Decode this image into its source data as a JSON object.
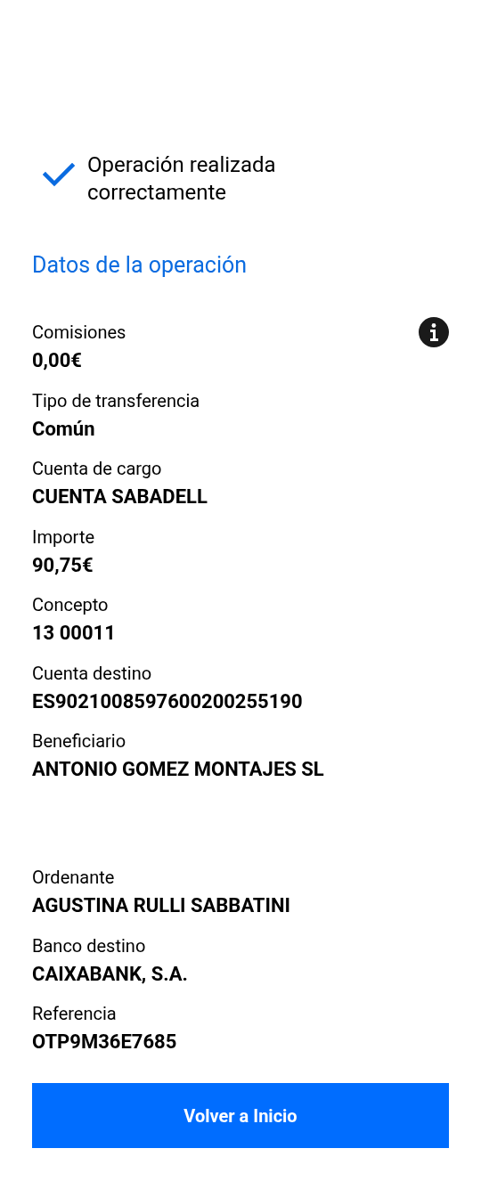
{
  "status": {
    "title": "Operación realizada correctamente"
  },
  "heading": "Datos de la operación",
  "details": [
    {
      "label": "Comisiones",
      "value": "0,00€",
      "info": true
    },
    {
      "label": "Tipo de transferencia",
      "value": "Común",
      "info": false
    },
    {
      "label": "Cuenta de cargo",
      "value": "CUENTA SABADELL",
      "info": false
    },
    {
      "label": "Importe",
      "value": "90,75€",
      "info": false
    },
    {
      "label": "Concepto",
      "value": "13 00011",
      "info": false
    },
    {
      "label": "Cuenta destino",
      "value": "ES9021008597600200255190",
      "info": false
    },
    {
      "label": "Beneficiario",
      "value": "ANTONIO GOMEZ MONTAJES SL",
      "info": false
    }
  ],
  "parties": [
    {
      "label": "Ordenante",
      "value": "AGUSTINA RULLI SABBATINI",
      "info": false
    },
    {
      "label": "Banco destino",
      "value": "CAIXABANK, S.A.",
      "info": false
    },
    {
      "label": "Referencia",
      "value": "OTP9M36E7685",
      "info": false
    }
  ],
  "button": "Volver a Inicio"
}
